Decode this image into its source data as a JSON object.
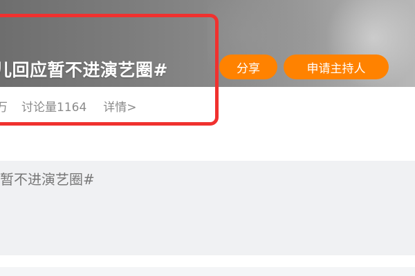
{
  "header": {
    "title": "儿回应暂不进演艺圈#",
    "stats": {
      "views_fragment": "万",
      "discussions": "讨论量1164",
      "detail_link": "详情>"
    },
    "actions": {
      "share_label": "分享",
      "host_label": "申请主持人"
    }
  },
  "content": {
    "snippet": "暂不进演艺圈#"
  },
  "colors": {
    "accent": "#ff8200",
    "highlight_border": "#f0312f",
    "panel_bg": "#f0f1f3",
    "muted_text": "#8a8a8a"
  }
}
